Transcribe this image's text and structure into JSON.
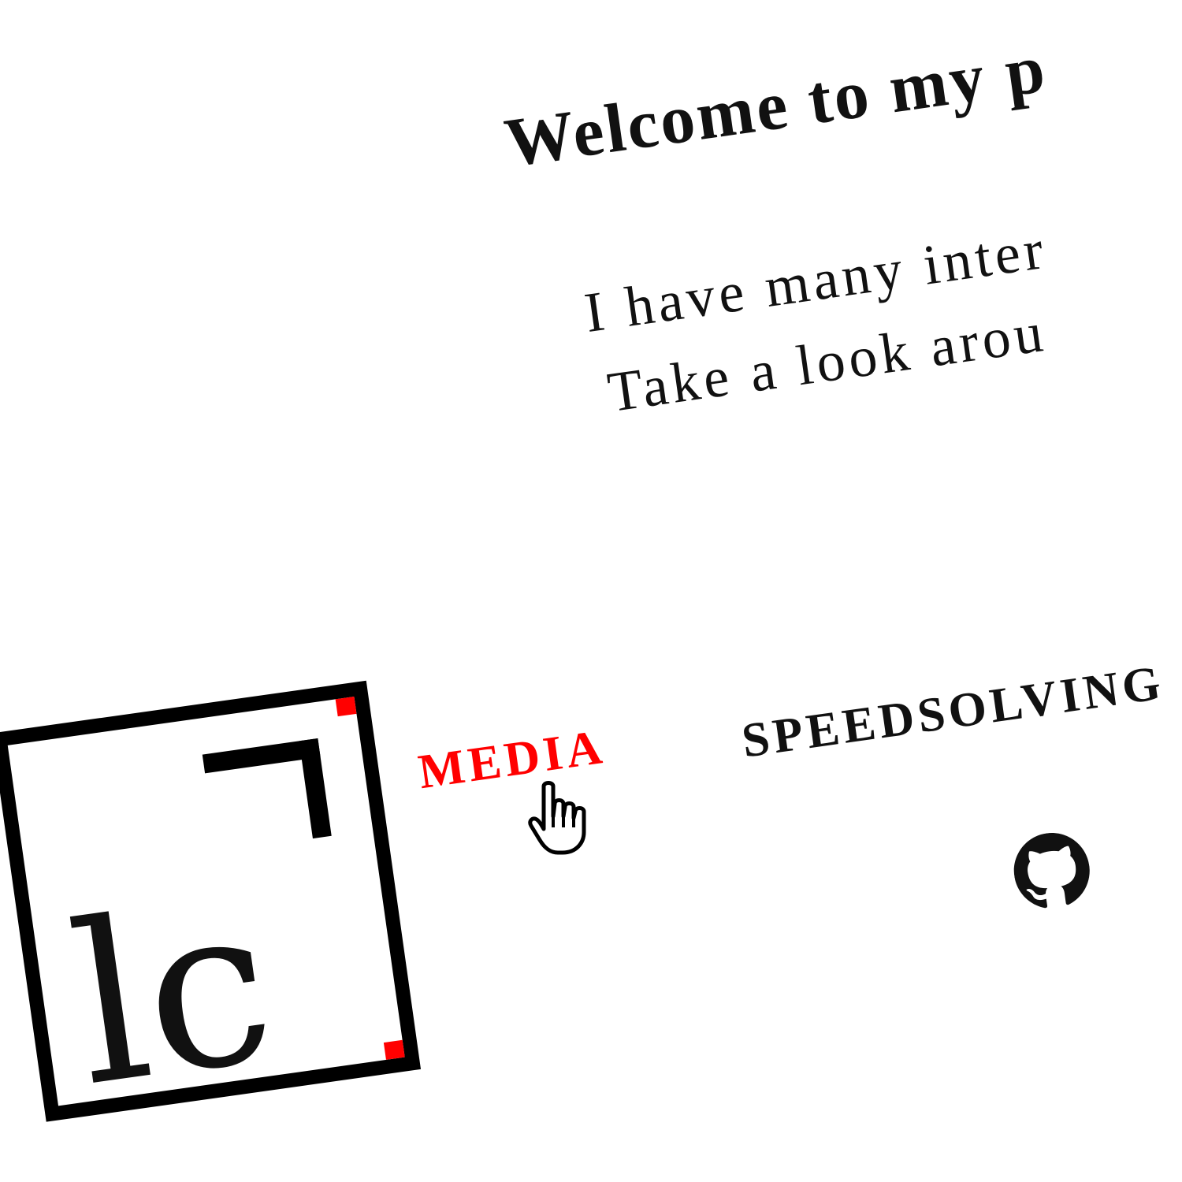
{
  "heading": "Welcome to my p",
  "intro": {
    "line1": "I have many inter",
    "line2": "Take a look arou"
  },
  "nav": {
    "media": "MEDIA",
    "speedsolving": "SPEEDSOLVING"
  },
  "logo": {
    "text": "lc"
  },
  "icons": {
    "github": "github-icon",
    "cursor": "hand-pointer-cursor-icon"
  },
  "colors": {
    "accent": "#ff0000",
    "text": "#111111",
    "background": "#ffffff"
  }
}
